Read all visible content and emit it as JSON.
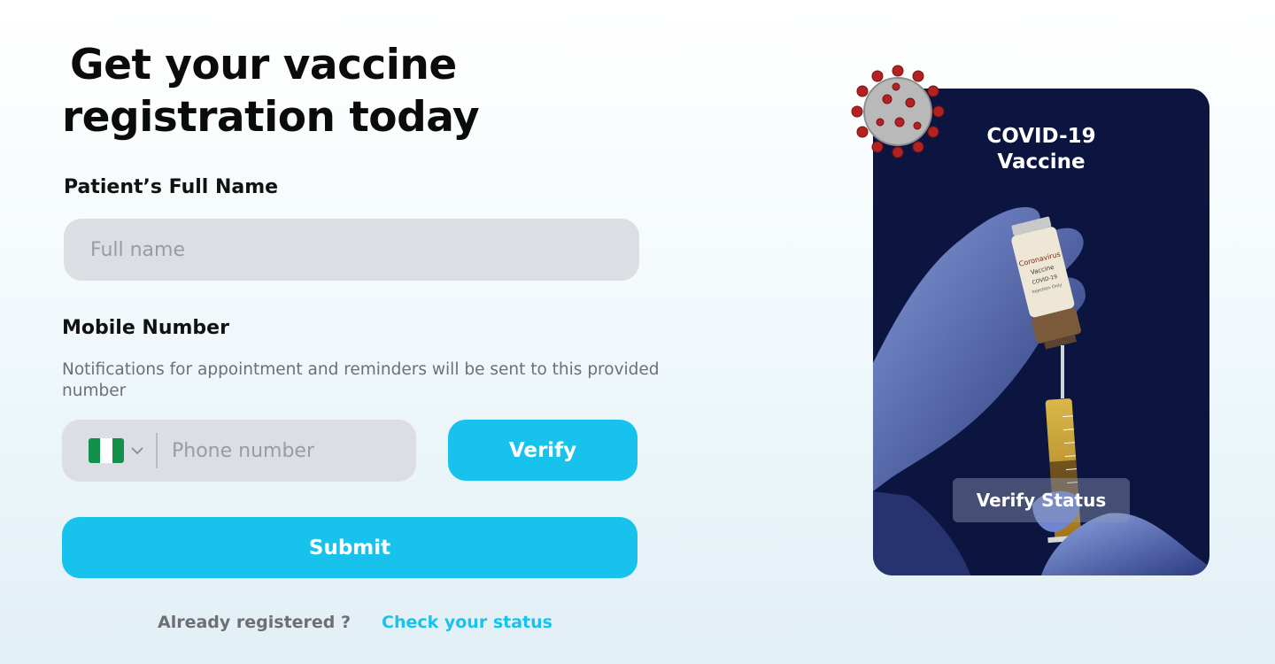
{
  "title": {
    "line1": "Get your vaccine",
    "line2": "registration today"
  },
  "full_name": {
    "label": "Patient’s Full Name",
    "placeholder": "Full name"
  },
  "mobile": {
    "label": "Mobile Number",
    "helper": "Notifications for appointment and reminders will be sent to this provided number",
    "placeholder": "Phone number",
    "country_flag": "nigeria-flag",
    "verify_label": "Verify"
  },
  "submit_label": "Submit",
  "footer": {
    "question": "Already registered ?",
    "link": "Check your status"
  },
  "card": {
    "title_line1": "COVID-19",
    "title_line2": "Vaccine",
    "vial_text": [
      "Coronavirus",
      "Vaccine",
      "COVID-19",
      "Injection Only"
    ],
    "verify_status_label": "Verify Status"
  },
  "colors": {
    "accent": "#17c2ec",
    "card_bg": "#0c1440",
    "input_bg": "#dcdee3"
  }
}
